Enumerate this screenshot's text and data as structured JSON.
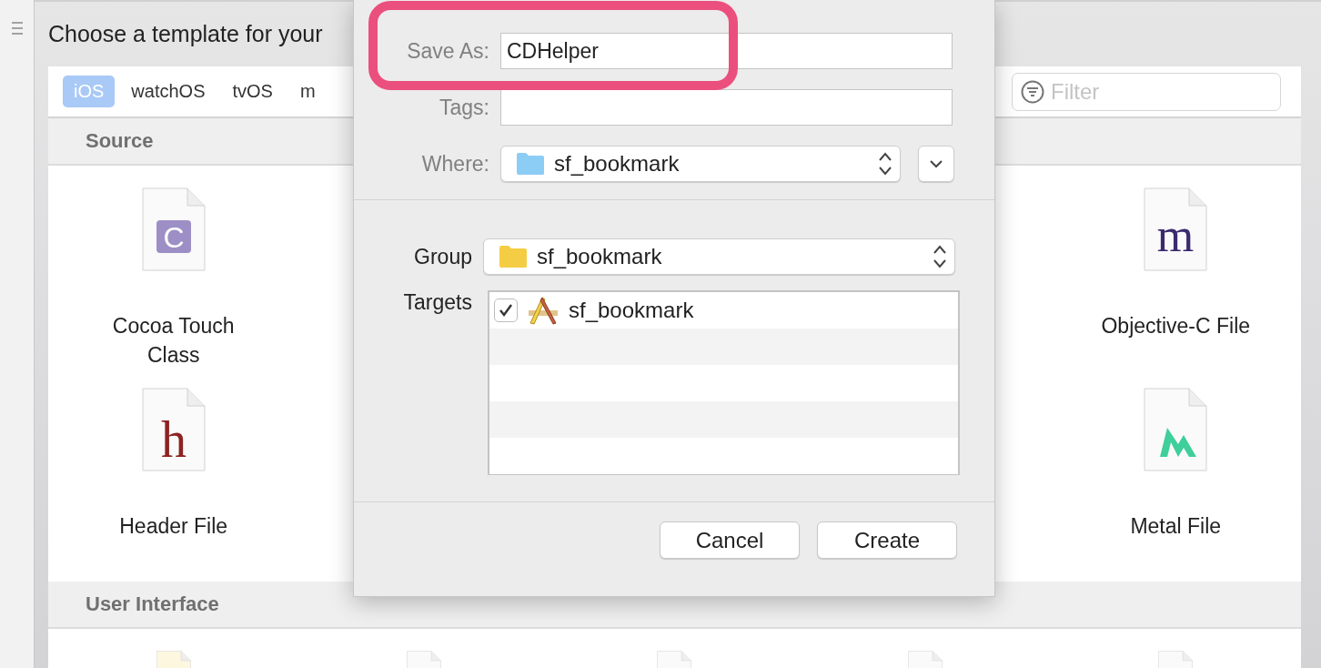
{
  "window": {
    "title": "Choose a template for your"
  },
  "platform_tabs": [
    {
      "label": "iOS",
      "selected": true
    },
    {
      "label": "watchOS",
      "selected": false
    },
    {
      "label": "tvOS",
      "selected": false
    },
    {
      "label": "m",
      "selected": false
    }
  ],
  "filter": {
    "placeholder": "Filter"
  },
  "sections": [
    {
      "title": "Source",
      "templates": [
        {
          "kind": "class",
          "glyph": "C",
          "label": "Cocoa Touch Class"
        },
        {
          "kind": "objc",
          "glyph": "m",
          "label": "Objective-C File"
        },
        {
          "kind": "header",
          "glyph": "h",
          "label": "Header File"
        },
        {
          "kind": "metal",
          "label": "Metal File"
        }
      ]
    },
    {
      "title": "User Interface",
      "templates": [
        {
          "kind": "storyboard"
        },
        {
          "kind": "plain"
        },
        {
          "kind": "plain"
        },
        {
          "kind": "plain"
        },
        {
          "kind": "plain"
        }
      ]
    }
  ],
  "dialog": {
    "save_as": {
      "label": "Save As:",
      "value": "CDHelper",
      "highlighted": true
    },
    "tags": {
      "label": "Tags:"
    },
    "where": {
      "label": "Where:",
      "value": "sf_bookmark"
    },
    "group": {
      "label": "Group",
      "value": "sf_bookmark"
    },
    "targets": {
      "label": "Targets",
      "items": [
        {
          "name": "sf_bookmark",
          "checked": true
        }
      ]
    },
    "buttons": [
      "Cancel",
      "Create"
    ]
  }
}
